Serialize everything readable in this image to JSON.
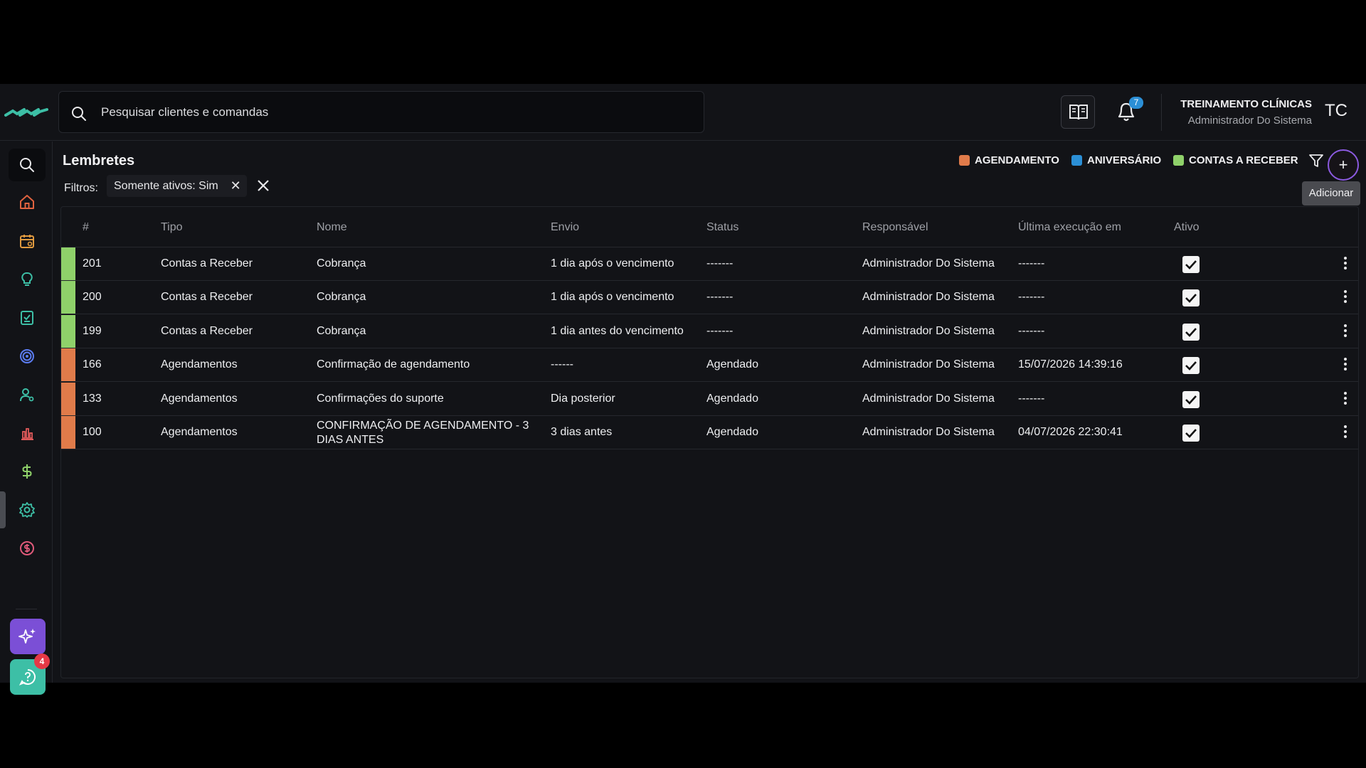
{
  "header": {
    "search_placeholder": "Pesquisar clientes e comandas",
    "notification_count": "7",
    "user_name": "TREINAMENTO CLÍNICAS",
    "user_role": "Administrador Do Sistema",
    "avatar_initials": "TC"
  },
  "sidebar": {
    "items": [
      "search-icon",
      "home-icon",
      "calendar-icon",
      "lightbulb-icon",
      "checklist-icon",
      "target-icon",
      "users-icon",
      "chart-icon",
      "dollar-icon",
      "gear-icon",
      "coin-icon"
    ],
    "active_item": "gear-icon",
    "chat_badge": "4"
  },
  "page": {
    "title": "Lembretes",
    "filters_label": "Filtros:",
    "filter_chip": "Somente ativos: Sim",
    "add_tooltip": "Adicionar"
  },
  "legend": [
    {
      "label": "AGENDAMENTO",
      "color": "#e07b4a"
    },
    {
      "label": "ANIVERSÁRIO",
      "color": "#2b8fd6"
    },
    {
      "label": "CONTAS A RECEBER",
      "color": "#8fd16a"
    }
  ],
  "table": {
    "columns": [
      "#",
      "Tipo",
      "Nome",
      "Envio",
      "Status",
      "Responsável",
      "Última execução em",
      "Ativo"
    ],
    "rows": [
      {
        "color": "#8fd16a",
        "id": "201",
        "tipo": "Contas a Receber",
        "nome": "Cobrança",
        "nome2": "",
        "envio": "1 dia após o vencimento",
        "status": "-------",
        "responsavel": "Administrador Do Sistema",
        "ultima": "-------",
        "ativo": true
      },
      {
        "color": "#8fd16a",
        "id": "200",
        "tipo": "Contas a Receber",
        "nome": "Cobrança",
        "nome2": "",
        "envio": "1 dia após o vencimento",
        "status": "-------",
        "responsavel": "Administrador Do Sistema",
        "ultima": "-------",
        "ativo": true
      },
      {
        "color": "#8fd16a",
        "id": "199",
        "tipo": "Contas a Receber",
        "nome": "Cobrança",
        "nome2": "",
        "envio": "1 dia antes do vencimento",
        "status": "-------",
        "responsavel": "Administrador Do Sistema",
        "ultima": "-------",
        "ativo": true
      },
      {
        "color": "#e07b4a",
        "id": "166",
        "tipo": "Agendamentos",
        "nome": "Confirmação de agendamento",
        "nome2": "",
        "envio": "------",
        "status": "Agendado",
        "responsavel": "Administrador Do Sistema",
        "ultima": "15/07/2026 14:39:16",
        "ativo": true
      },
      {
        "color": "#e07b4a",
        "id": "133",
        "tipo": "Agendamentos",
        "nome": "Confirmações do suporte",
        "nome2": "",
        "envio": "Dia posterior",
        "status": "Agendado",
        "responsavel": "Administrador Do Sistema",
        "ultima": "-------",
        "ativo": true
      },
      {
        "color": "#e07b4a",
        "id": "100",
        "tipo": "Agendamentos",
        "nome": "CONFIRMAÇÃO DE AGENDAMENTO - 3",
        "nome2": "DIAS ANTES",
        "envio": "3 dias antes",
        "status": "Agendado",
        "responsavel": "Administrador Do Sistema",
        "ultima": "04/07/2026 22:30:41",
        "ativo": true
      }
    ]
  }
}
